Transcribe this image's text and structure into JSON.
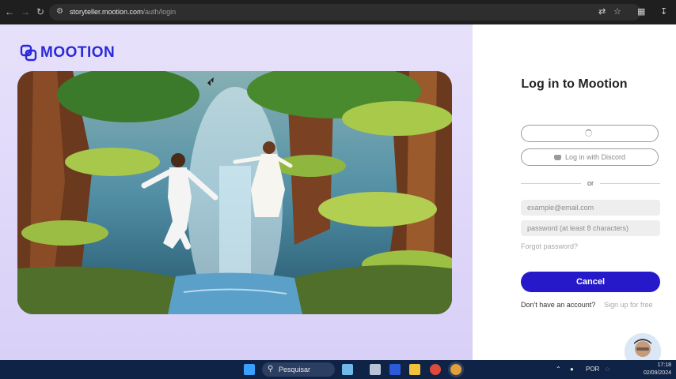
{
  "browser": {
    "url_host": "storyteller.mootion.com",
    "url_path": "/auth/login",
    "icons": [
      "back-icon",
      "forward-icon",
      "reload-icon",
      "site-settings-icon",
      "translate-icon",
      "star-icon",
      "extensions-icon",
      "download-icon"
    ]
  },
  "brand": {
    "name": "MOOTION",
    "color": "#2b2ad8"
  },
  "login": {
    "title": "Log in to Mootion",
    "discord_label": "Log in with Discord",
    "or_label": "or",
    "email_placeholder": "example@email.com",
    "password_placeholder": "password (at least 8 characters)",
    "forgot_label": "Forgot password?",
    "cancel_label": "Cancel",
    "no_account_label": "Don't have an account?",
    "signup_label": "Sign up for free",
    "accent": "#2619c9"
  },
  "taskbar": {
    "search_label": "Pesquisar",
    "language": "POR",
    "time": "17:18",
    "date": "02/09/2024",
    "color": "#0f2346"
  }
}
